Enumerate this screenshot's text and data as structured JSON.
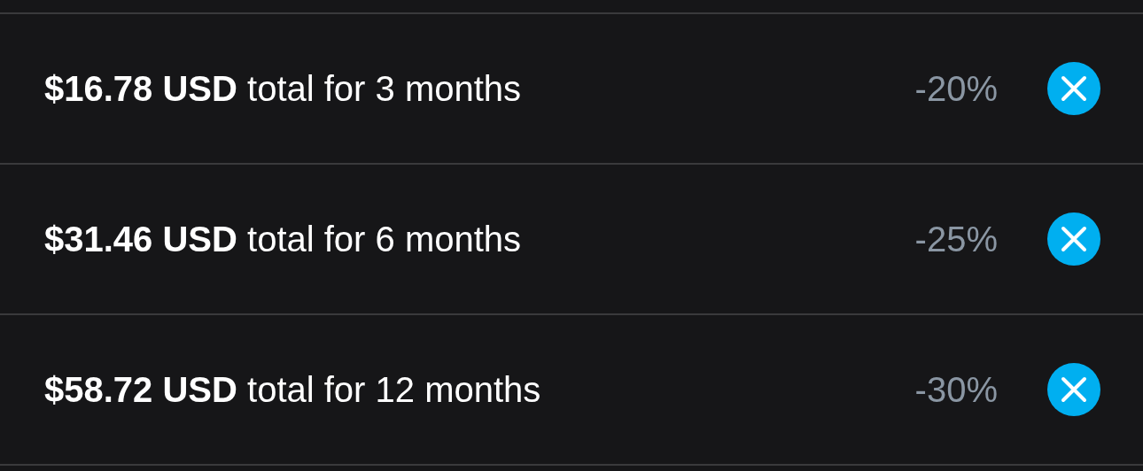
{
  "bundles": [
    {
      "label": "**$16.78 USD** total for 3 months",
      "discount": "-20%"
    },
    {
      "label": "**$31.46 USD** total for 6 months",
      "discount": "-25%"
    },
    {
      "label": "**$58.72 USD** total for 12 months",
      "discount": "-30%"
    }
  ]
}
